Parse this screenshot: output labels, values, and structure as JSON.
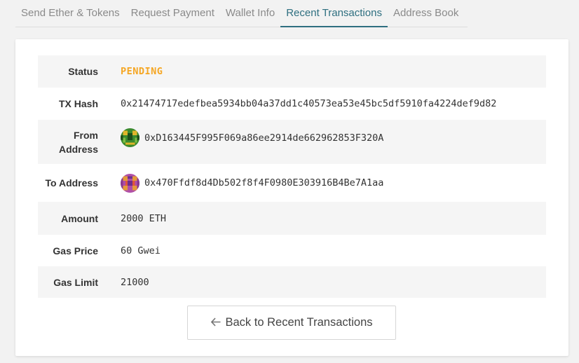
{
  "tabs": [
    {
      "label": "Send Ether & Tokens"
    },
    {
      "label": "Request Payment"
    },
    {
      "label": "Wallet Info"
    },
    {
      "label": "Recent Transactions"
    },
    {
      "label": "Address Book"
    }
  ],
  "active_tab": "Recent Transactions",
  "transaction": {
    "status_label": "Status",
    "status_value": "PENDING",
    "status_color": "#f5a623",
    "hash_label": "TX Hash",
    "hash_value": "0x21474717edefbea5934bb04a37dd1c40573ea53e45bc5df5910fa4224def9d82",
    "from_label": "From Address",
    "from_value": "0xD163445F995F069a86ee2914de662962853F320A",
    "to_label": "To Address",
    "to_value": "0x470Ffdf8d4Db502f8f4F0980E303916B4Be7A1aa",
    "amount_label": "Amount",
    "amount_value": "2000 ETH",
    "gas_price_label": "Gas Price",
    "gas_price_value": "60 Gwei",
    "gas_limit_label": "Gas Limit",
    "gas_limit_value": "21000"
  },
  "back_button": {
    "icon": "arrow-left-icon",
    "label": "Back to Recent Transactions"
  },
  "colors": {
    "accent": "#2e6f80",
    "pending": "#f5a623"
  }
}
